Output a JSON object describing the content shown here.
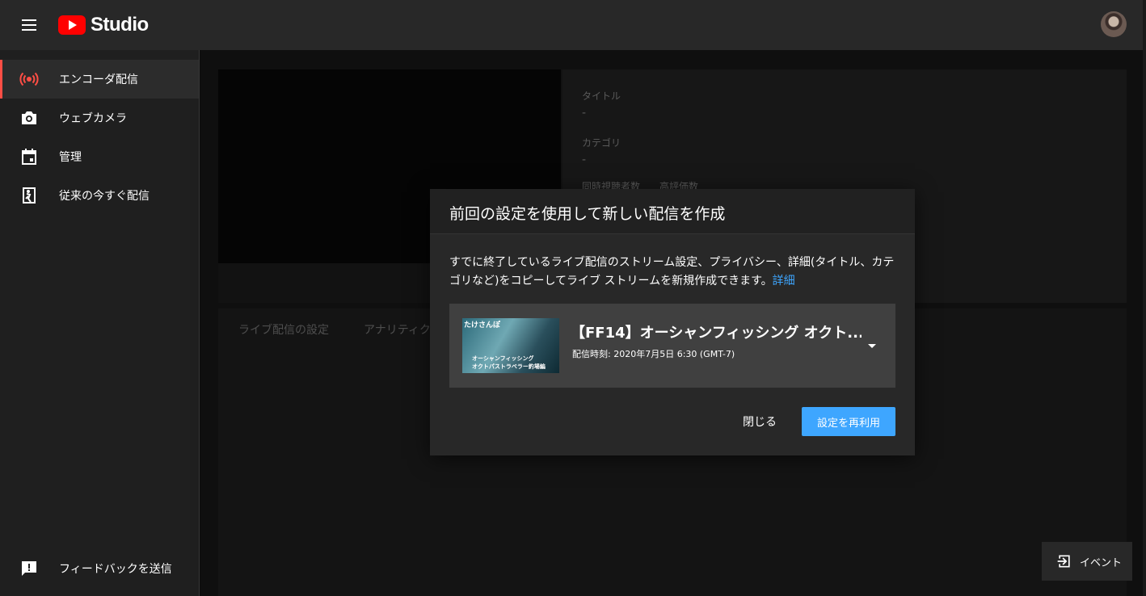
{
  "app": {
    "logo_text": "Studio",
    "brand_color": "#ff0000"
  },
  "sidebar": {
    "items": [
      {
        "label": "エンコーダ配信",
        "icon": "live-broadcast-icon",
        "active": true
      },
      {
        "label": "ウェブカメラ",
        "icon": "camera-icon"
      },
      {
        "label": "管理",
        "icon": "calendar-icon"
      },
      {
        "label": "従来の今すぐ配信",
        "icon": "legacy-stream-icon"
      }
    ],
    "feedback_label": "フィードバックを送信"
  },
  "background": {
    "title_label": "タイトル",
    "title_value": "-",
    "category_label": "カテゴリ",
    "category_value": "-",
    "concurrent_viewers_label": "同時視聴者数",
    "likes_label": "高評価数",
    "tabs": [
      "ライブ配信の設定",
      "アナリティクス"
    ]
  },
  "dialog": {
    "title": "前回の設定を使用して新しい配信を作成",
    "description": "すでに終了しているライブ配信のストリーム設定、プライバシー、詳細(タイトル、カテゴリなど)をコピーしてライブ ストリームを新規作成できます。",
    "link_text": "詳細",
    "stream": {
      "title": "【FF14】オーシャンフィッシング オクト...",
      "time": "配信時刻: 2020年7月5日 6:30 (GMT-7)",
      "thumbnail_text_a": "たけさんぽ",
      "thumbnail_text_b": "オーシャンフィッシング",
      "thumbnail_text_c": "オクトパストラベラー釣場編"
    },
    "close_label": "閉じる",
    "reuse_label": "設定を再利用",
    "accent_color": "#3ea6ff"
  },
  "event_button": {
    "label": "イベント"
  }
}
